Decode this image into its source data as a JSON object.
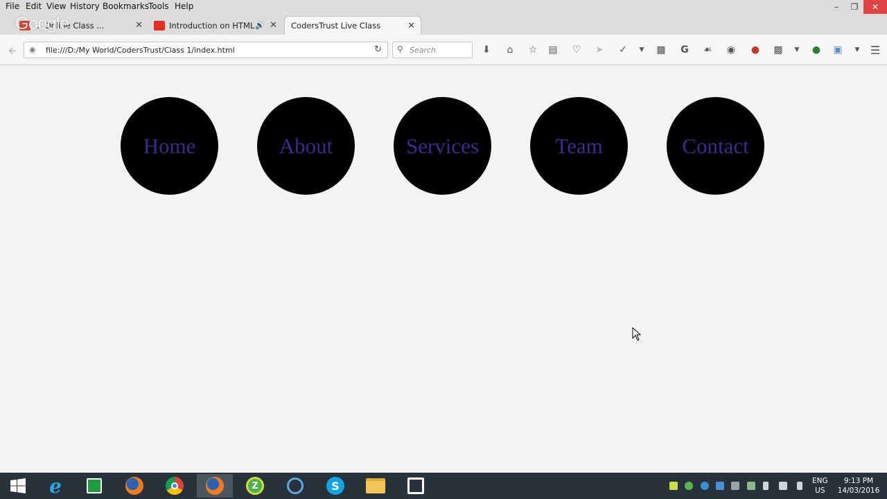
{
  "browser": {
    "menu": [
      "File",
      "Edit",
      "View",
      "History",
      "Bookmarks",
      "Tools",
      "Help"
    ],
    "menu_accel": [
      "F",
      "E",
      "V",
      "S",
      "B",
      "T",
      "H"
    ],
    "tabs": [
      {
        "title": "...  Online Class ...",
        "icon": "gmail-icon",
        "active": false
      },
      {
        "title": "Introduction on HTML...",
        "icon": "youtube-icon",
        "active": false
      },
      {
        "title": "CodersTrust Live Class",
        "icon": "",
        "active": true
      }
    ],
    "url": "file:///D:/My World/CodersTrust/Class 1/index.html",
    "search_placeholder": "Search",
    "badge_count": "15",
    "overlay_logo": "Google"
  },
  "page": {
    "nav_items": [
      "Home",
      "About",
      "Services",
      "Team",
      "Contact"
    ],
    "nav_text_color": "#3d2a8e",
    "circle_color": "#000000",
    "background": "#f3f3f3"
  },
  "taskbar": {
    "apps": [
      "windows-start-icon",
      "internet-explorer-icon",
      "store-icon",
      "firefox-icon",
      "chrome-icon",
      "firefox-icon",
      "zune-icon",
      "cortana-icon",
      "skype-icon",
      "file-explorer-icon",
      "app-icon"
    ],
    "language": "ENG",
    "region": "US",
    "time": "9:13 PM",
    "date": "14/03/2016"
  }
}
